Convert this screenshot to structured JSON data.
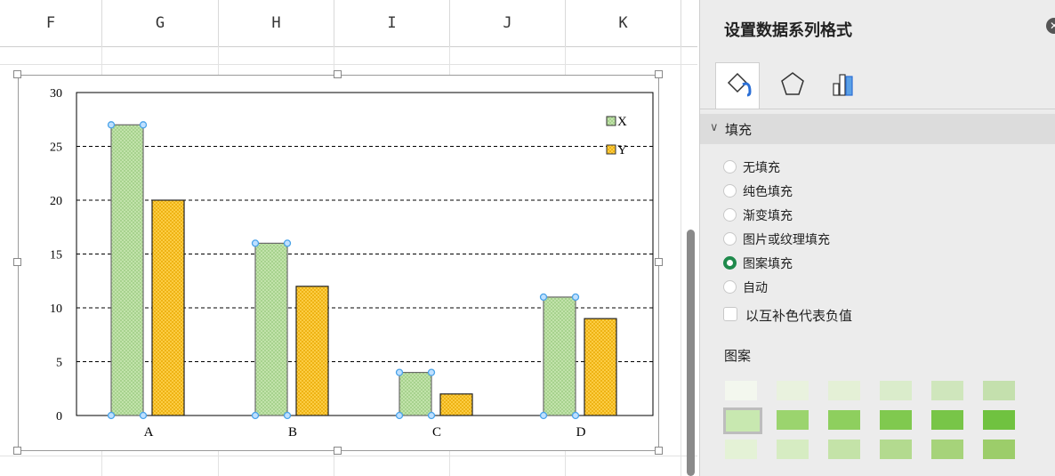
{
  "spreadsheet": {
    "columns": [
      "F",
      "G",
      "H",
      "I",
      "J",
      "K"
    ]
  },
  "chart_data": {
    "type": "bar",
    "categories": [
      "A",
      "B",
      "C",
      "D"
    ],
    "series": [
      {
        "name": "X",
        "values": [
          27,
          16,
          4,
          11
        ]
      },
      {
        "name": "Y",
        "values": [
          20,
          12,
          2,
          9
        ]
      }
    ],
    "ylim": [
      0,
      30
    ],
    "yticks": [
      0,
      5,
      10,
      15,
      20,
      25,
      30
    ],
    "grid": true,
    "legend_position": "top-right",
    "colors": {
      "X": "#c7e6b0",
      "Y": "#ffd24d",
      "x_border": "#6a6a6a",
      "y_border": "#222222",
      "selection": "#4aa3e8"
    }
  },
  "panel": {
    "title": "设置数据系列格式",
    "close_icon": "close-icon",
    "tabs": [
      {
        "name": "fill-line",
        "icon": "paint-bucket-icon"
      },
      {
        "name": "effects",
        "icon": "pentagon-icon"
      },
      {
        "name": "series-options",
        "icon": "bar-chart-icon"
      }
    ],
    "section": "填充",
    "fill_options": [
      {
        "label": "无填充",
        "selected": false
      },
      {
        "label": "纯色填充",
        "selected": false
      },
      {
        "label": "渐变填充",
        "selected": false
      },
      {
        "label": "图片或纹理填充",
        "selected": false
      },
      {
        "label": "图案填充",
        "selected": true
      },
      {
        "label": "自动",
        "selected": false
      }
    ],
    "invert_label": "以互补色代表负值",
    "pattern_label": "图案",
    "accent_color": "#1f8a4c"
  }
}
